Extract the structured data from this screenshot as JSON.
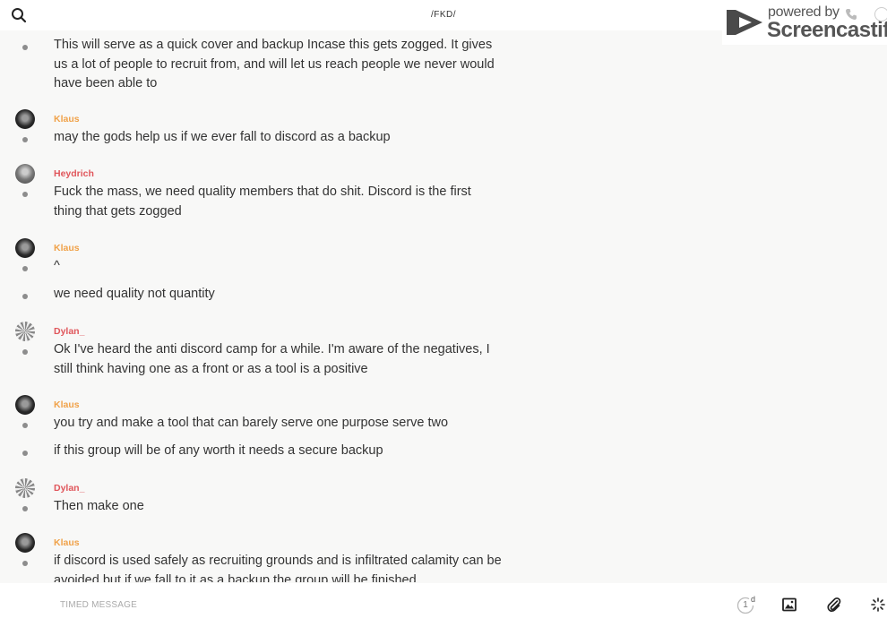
{
  "header": {
    "channel": "/FKD/",
    "search_icon": "search-icon"
  },
  "watermark": {
    "powered": "powered by",
    "brand": "Screencastify"
  },
  "messages": [
    {
      "author": "",
      "lines": [
        "This will serve as a quick cover and backup Incase this gets zogged. It gives us a lot of people to recruit from, and will let us reach people we never would have been able to"
      ]
    },
    {
      "author": "Klaus",
      "lines": [
        "may the gods help us if we ever fall to discord as a backup"
      ]
    },
    {
      "author": "Heydrich",
      "lines": [
        "Fuck the mass, we need quality members that do shit. Discord is the first thing that gets zogged"
      ]
    },
    {
      "author": "Klaus",
      "lines": [
        "^",
        "we need quality not quantity"
      ]
    },
    {
      "author": "Dylan_",
      "lines": [
        "Ok I've heard the anti discord camp for a while. I'm aware of the negatives, I still think having one as a front or as a tool is a positive"
      ]
    },
    {
      "author": "Klaus",
      "lines": [
        "you try and make a tool that can barely serve one purpose serve two",
        "if this group will be of any worth it needs a secure backup"
      ]
    },
    {
      "author": "Dylan_",
      "lines": [
        "Then make one"
      ]
    },
    {
      "author": "Klaus",
      "lines": [
        "if discord is used safely as recruiting grounds and is infiltrated calamity can be avoided but if we fall to it as a backup the group will be finished"
      ]
    }
  ],
  "composer": {
    "placeholder": "TIMED MESSAGE",
    "timer_value": "1",
    "timer_unit": "d"
  },
  "colors": {
    "klaus": "#f0a24a",
    "heydrich": "#e0565b",
    "dylan": "#e0565b"
  }
}
